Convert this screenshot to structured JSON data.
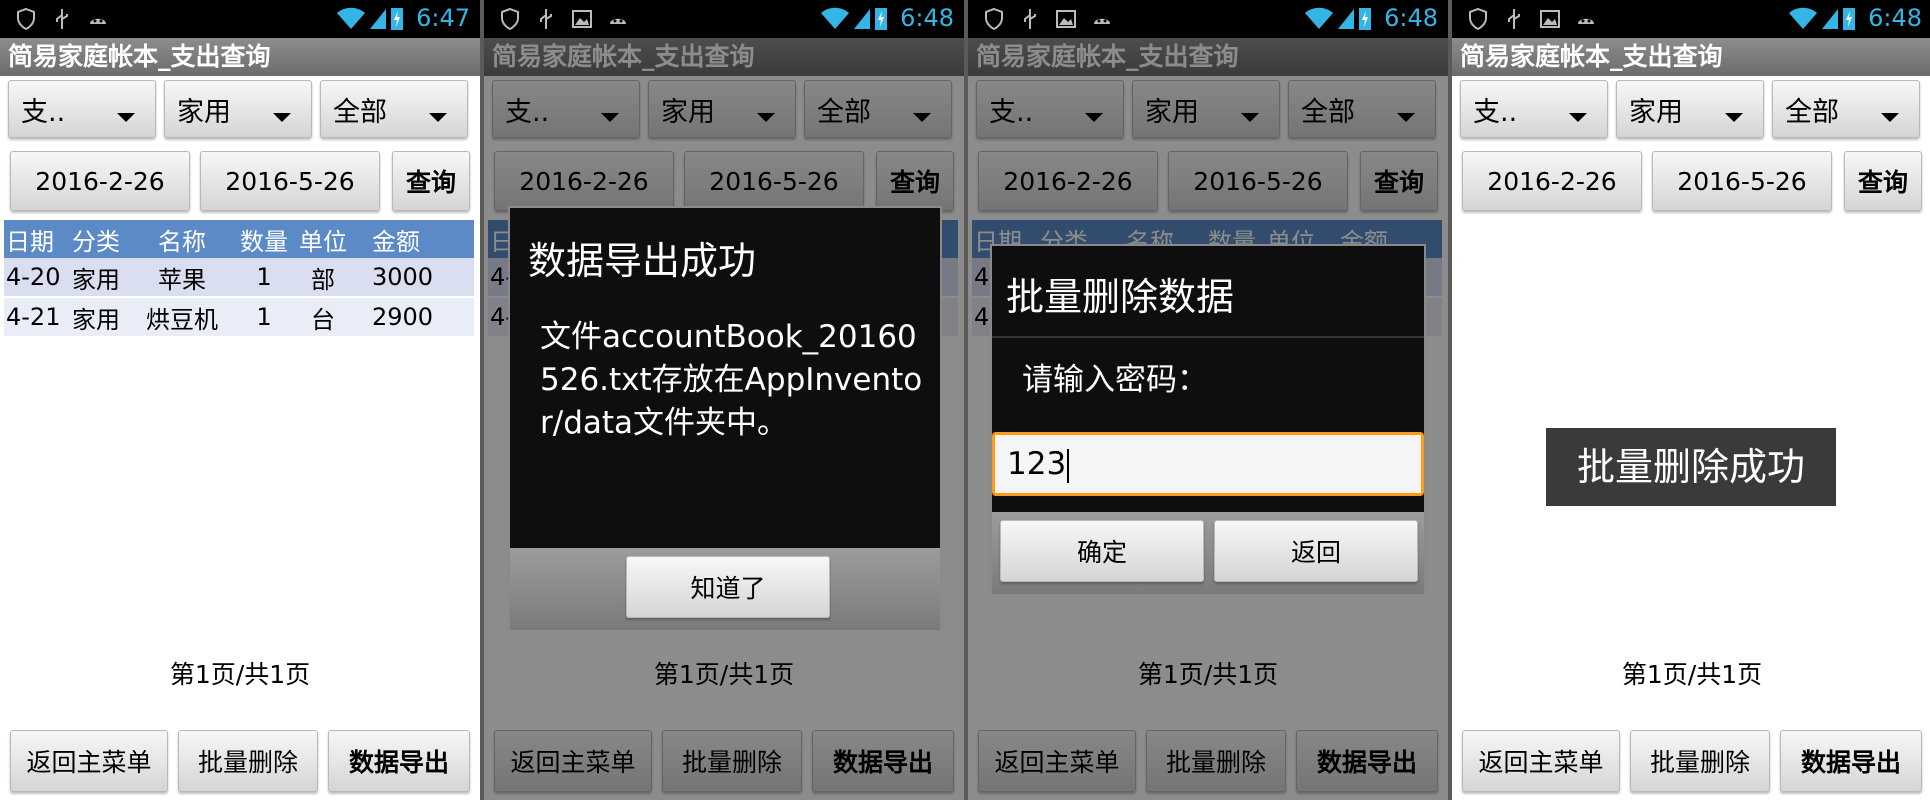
{
  "status_bar": [
    {
      "time": "6:47"
    },
    {
      "time": "6:48"
    },
    {
      "time": "6:48"
    },
    {
      "time": "6:48"
    }
  ],
  "app": {
    "title": "简易家庭帐本_支出查询"
  },
  "filters": {
    "type": "支..",
    "category": "家用",
    "name": "全部"
  },
  "dates": {
    "start": "2016-2-26",
    "end": "2016-5-26"
  },
  "query_button": "查询",
  "table": {
    "headers": [
      "日期",
      "分类",
      "名称",
      "数量",
      "单位",
      "金额"
    ],
    "rows": [
      [
        "4-20",
        "家用",
        "苹果",
        "1",
        "部",
        "3000"
      ],
      [
        "4-21",
        "家用",
        "烘豆机",
        "1",
        "台",
        "2900"
      ]
    ]
  },
  "page_info": "第1页/共1页",
  "bottom_buttons": {
    "back": "返回主菜单",
    "batch_delete": "批量删除",
    "export": "数据导出"
  },
  "export_dialog": {
    "title": "数据导出成功",
    "message": "文件accountBook_20160526.txt存放在AppInventor/data文件夹中。",
    "ok": "知道了"
  },
  "delete_dialog": {
    "title": "批量删除数据",
    "prompt": "请输入密码：",
    "input_value": "123",
    "confirm": "确定",
    "cancel": "返回"
  },
  "toast": "批量删除成功"
}
